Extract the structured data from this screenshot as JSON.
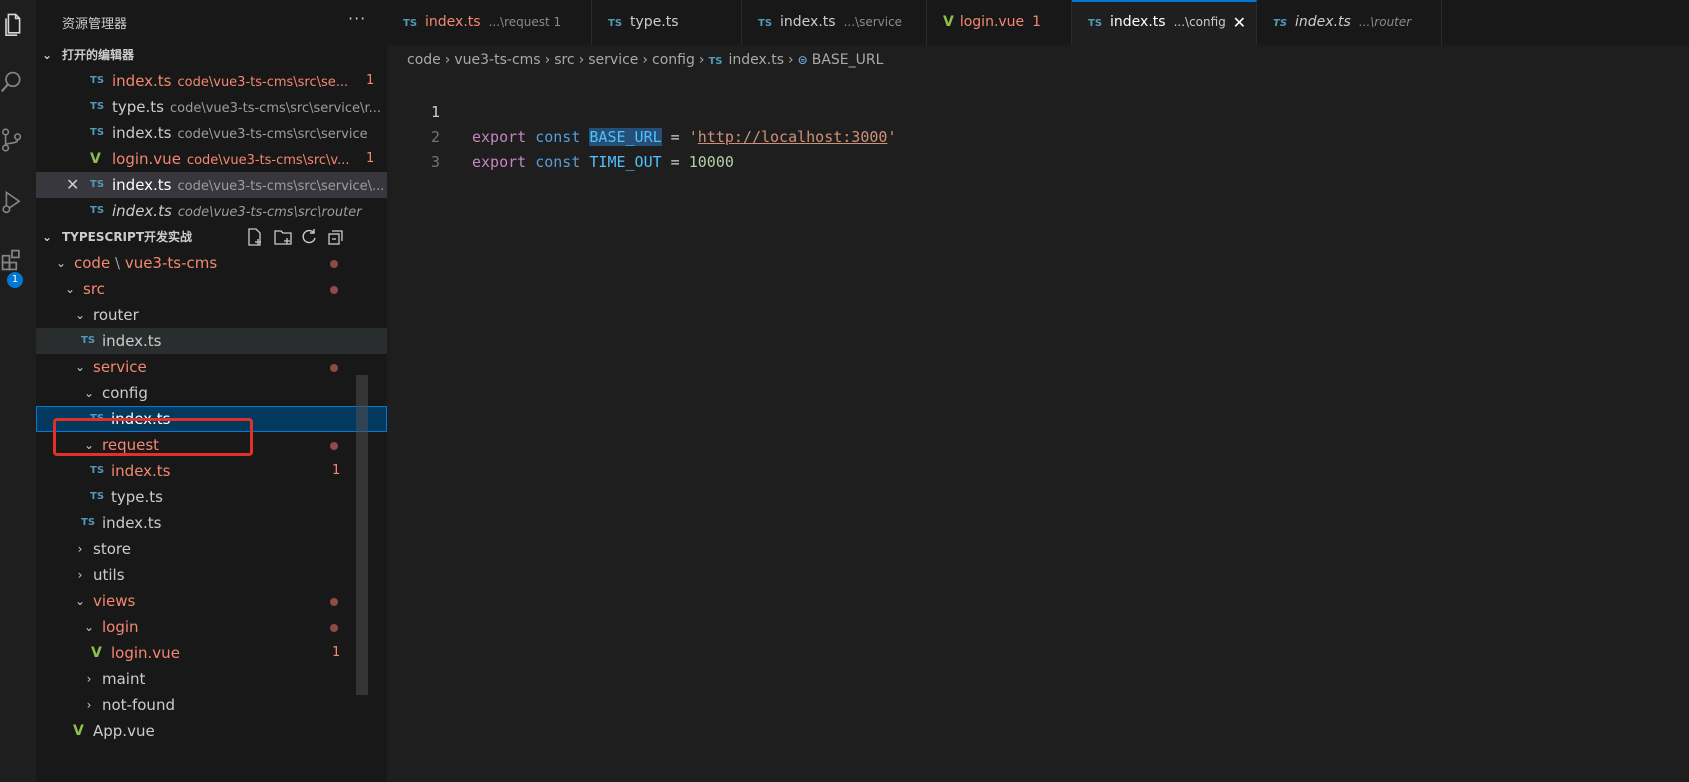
{
  "sidebar": {
    "title": "资源管理器",
    "more": "···",
    "open_editors_header": "打开的编辑器",
    "open_editors": [
      {
        "name": "index.ts",
        "path": "code\\vue3-ts-cms\\src\\se...",
        "count": "1",
        "state": "error",
        "icon": "TS"
      },
      {
        "name": "type.ts",
        "path": "code\\vue3-ts-cms\\src\\service\\r...",
        "count": "",
        "state": "normal",
        "icon": "TS"
      },
      {
        "name": "index.ts",
        "path": "code\\vue3-ts-cms\\src\\service",
        "count": "",
        "state": "normal",
        "icon": "TS"
      },
      {
        "name": "login.vue",
        "path": "code\\vue3-ts-cms\\src\\v...",
        "count": "1",
        "state": "error",
        "icon": "V"
      },
      {
        "name": "index.ts",
        "path": "code\\vue3-ts-cms\\src\\service\\...",
        "count": "",
        "state": "active",
        "icon": "TS"
      },
      {
        "name": "index.ts",
        "path": "code\\vue3-ts-cms\\src\\router",
        "count": "",
        "state": "italic",
        "icon": "TS"
      }
    ],
    "workspace_header": "TYPESCRIPT开发实战",
    "tree": {
      "root": "code",
      "root_sep": "\\",
      "root_sub": "vue3-ts-cms",
      "src": "src",
      "router": "router",
      "router_index": "index.ts",
      "service": "service",
      "config": "config",
      "config_index": "index.ts",
      "request": "request",
      "request_index": "index.ts",
      "request_index_count": "1",
      "request_type": "type.ts",
      "service_index": "index.ts",
      "store": "store",
      "utils": "utils",
      "views": "views",
      "login": "login",
      "login_vue": "login.vue",
      "login_vue_count": "1",
      "maint": "maint",
      "not_found": "not-found",
      "app_vue": "App.vue"
    },
    "badge": "1"
  },
  "tabs": [
    {
      "icon": "TS",
      "name": "index.ts",
      "desc": "...\\request 1",
      "state": "error"
    },
    {
      "icon": "TS",
      "name": "type.ts",
      "desc": "",
      "state": "normal"
    },
    {
      "icon": "TS",
      "name": "index.ts",
      "desc": "...\\service",
      "state": "normal"
    },
    {
      "icon": "V",
      "name": "login.vue",
      "desc": "1",
      "state": "error"
    },
    {
      "icon": "TS",
      "name": "index.ts",
      "desc": "...\\config",
      "state": "active"
    },
    {
      "icon": "TS",
      "name": "index.ts",
      "desc": "...\\router",
      "state": "italic"
    }
  ],
  "breadcrumbs": [
    "code",
    "vue3-ts-cms",
    "src",
    "service",
    "config",
    "index.ts",
    "BASE_URL"
  ],
  "breadcrumb_file_icon": "TS",
  "code": {
    "line_numbers": [
      "1",
      "2",
      "3"
    ],
    "line1": {
      "kw1": "export",
      "kw2": "const",
      "name": "BASE_URL",
      "eq": " = ",
      "q1": "'",
      "url": "http://localhost:3000",
      "q2": "'"
    },
    "line2": {
      "kw1": "export",
      "kw2": "const",
      "name": "TIME_OUT",
      "eq": " = ",
      "value": "10000"
    }
  },
  "colors": {
    "accent": "#0078d4",
    "error": "#f48771",
    "vue": "#8dc149",
    "ts": "#519aba"
  }
}
